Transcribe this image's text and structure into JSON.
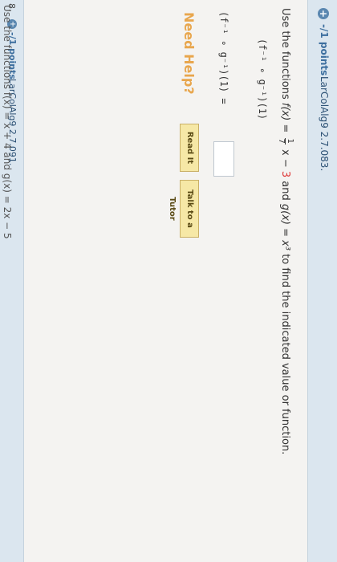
{
  "question": {
    "points": "-/1 points",
    "source": "LarColAlg9 2.7.083.",
    "prompt_start": "Use the functions",
    "f_name": "f(x) =",
    "frac_num": "1",
    "frac_den": "7",
    "f_rest": "x −",
    "f_const": "3",
    "and": "and",
    "g_def": "g(x) = x³",
    "prompt_end": "to find the indicated value or function.",
    "composition": "(f⁻¹ ∘ g⁻¹)(1)",
    "answer_label": "(f⁻¹ ∘ g⁻¹)(1) =",
    "answer_value": ""
  },
  "help": {
    "label": "Need Help?",
    "read_it": "Read It",
    "talk_tutor": "Talk to a Tutor"
  },
  "next_question": {
    "number": "8.",
    "points": "-/1 points",
    "source": "LarColAlg9 2.7.091.",
    "prompt": "Use the functions  f(x) = x + 4  and  g(x) = 2x − 5"
  },
  "colors": {
    "header_bg": "#dbe6ef",
    "accent_blue": "#3c6e9e",
    "need_help": "#e8a64d",
    "button_bg": "#f6e8a6"
  }
}
